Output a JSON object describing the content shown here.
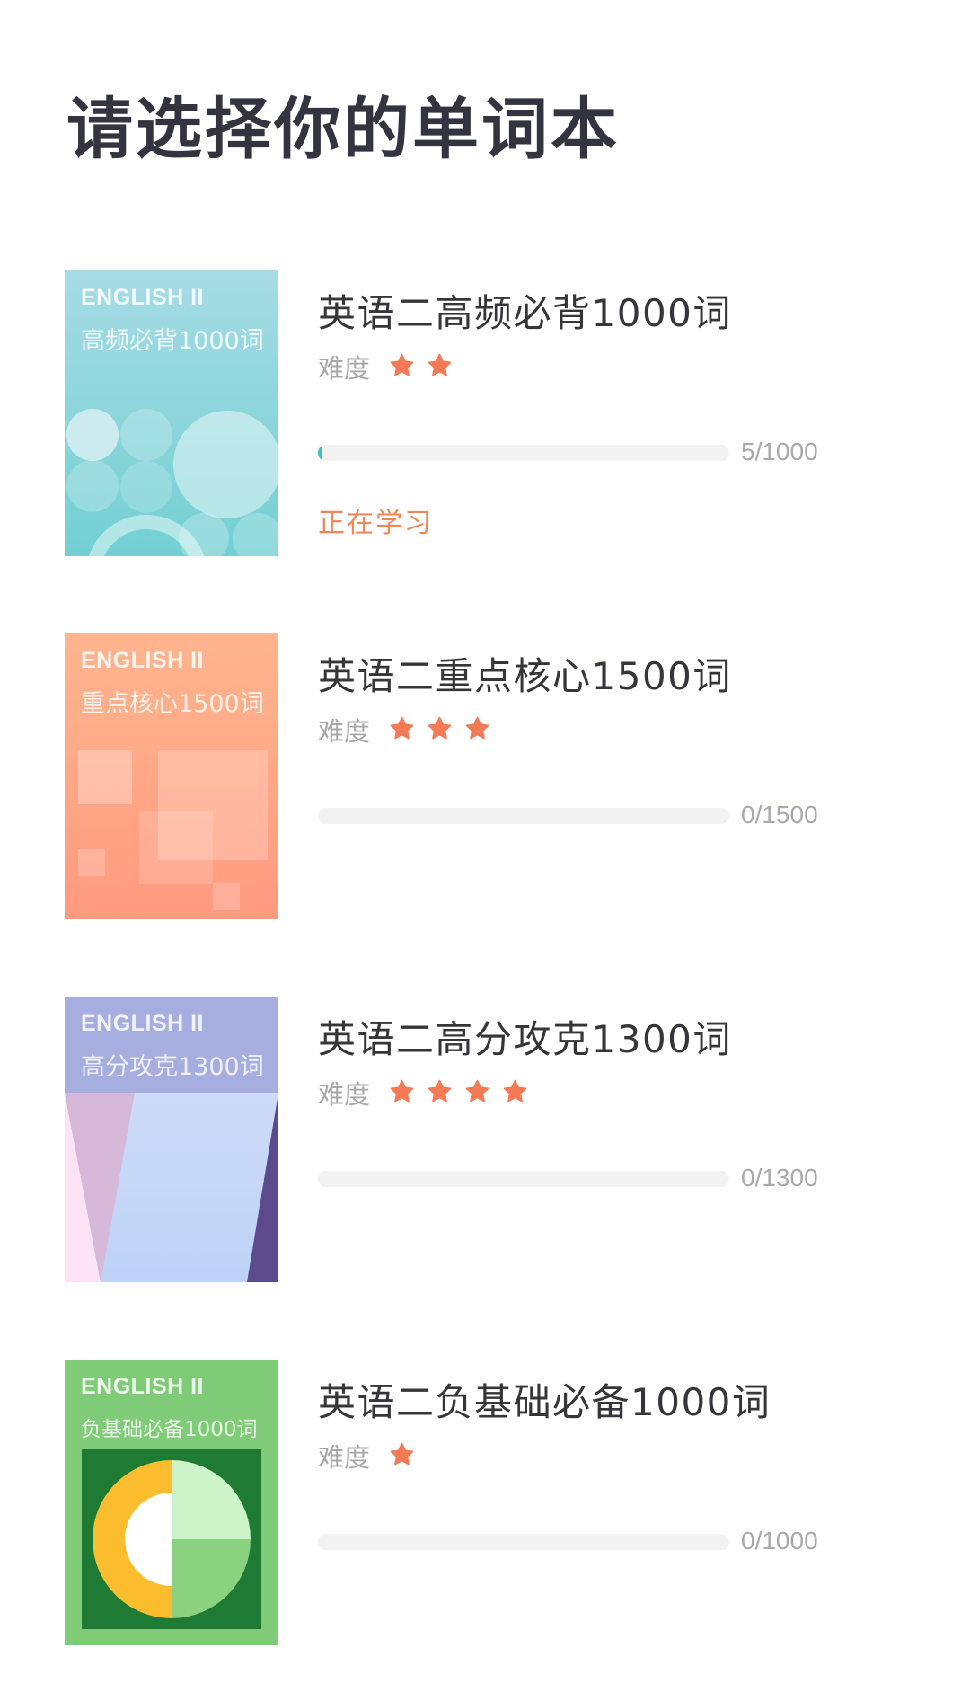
{
  "header": {
    "title": "请选择你的单词本"
  },
  "difficulty_label": "难度",
  "colors": {
    "star": "#f37a55",
    "status": "#f0875b",
    "progress_fill": "#3cc0c7"
  },
  "books": [
    {
      "cover_english": "ENGLISH II",
      "cover_subtitle": "高频必背1000词",
      "title": "英语二高频必背1000词",
      "difficulty": 2,
      "learned": 5,
      "total": 1000,
      "progress_text": "5/1000",
      "status": "正在学习"
    },
    {
      "cover_english": "ENGLISH II",
      "cover_subtitle": "重点核心1500词",
      "title": "英语二重点核心1500词",
      "difficulty": 3,
      "learned": 0,
      "total": 1500,
      "progress_text": "0/1500",
      "status": ""
    },
    {
      "cover_english": "ENGLISH II",
      "cover_subtitle": "高分攻克1300词",
      "title": "英语二高分攻克1300词",
      "difficulty": 4,
      "learned": 0,
      "total": 1300,
      "progress_text": "0/1300",
      "status": ""
    },
    {
      "cover_english": "ENGLISH II",
      "cover_subtitle": "负基础必备1000词",
      "title": "英语二负基础必备1000词",
      "difficulty": 1,
      "learned": 0,
      "total": 1000,
      "progress_text": "0/1000",
      "status": ""
    }
  ]
}
